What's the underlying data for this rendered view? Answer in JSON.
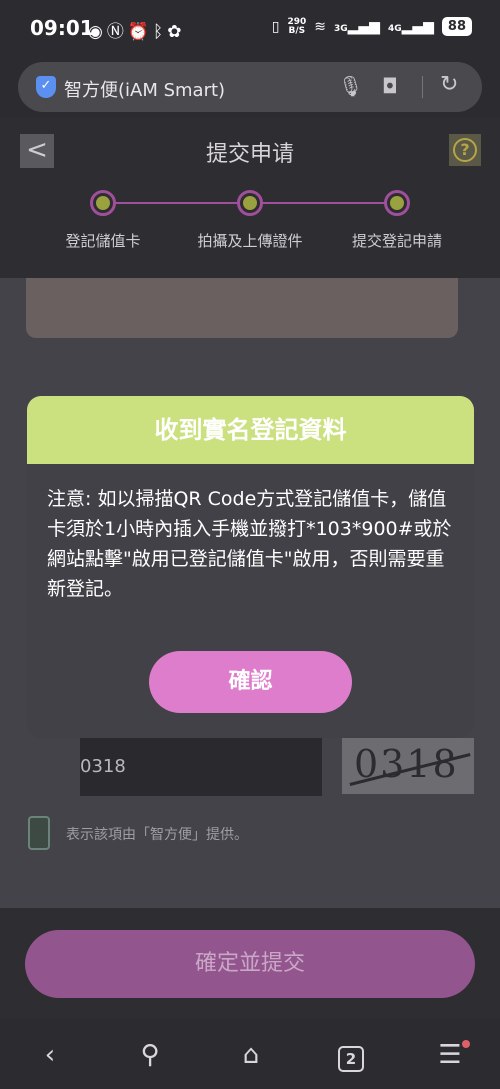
{
  "status_bar": {
    "time": "09:01",
    "left_icons": [
      "eye-icon",
      "nfc-icon",
      "alarm-icon",
      "bluetooth-icon",
      "app-icon"
    ],
    "net_speed_value": "290",
    "net_speed_unit": "B/S",
    "signal1": "3G",
    "signal2": "4G",
    "battery": "88"
  },
  "browser": {
    "url_text": "智方便(iAM Smart)",
    "tab_count": "2"
  },
  "header": {
    "title": "提交申请",
    "back_glyph": "<",
    "help_glyph": "?",
    "steps": [
      {
        "label": "登記儲值卡"
      },
      {
        "label": "拍攝及上傳證件"
      },
      {
        "label": "提交登記申請"
      }
    ]
  },
  "page": {
    "captcha_value": "0318",
    "captcha_image_text": "0318",
    "provided_by_note": "表示該項由「智方便」提供。",
    "submit_label": "確定並提交"
  },
  "modal": {
    "title": "收到實名登記資料",
    "body": "注意: 如以掃描QR Code方式登記儲值卡，儲值卡須於1小時內插入手機並撥打*103*900#或於網站點擊\"啟用已登記儲值卡\"啟用，否則需要重新登記。",
    "confirm_label": "確認"
  },
  "colors": {
    "modal_header": "#cbe07f",
    "confirm_button": "#de7dcb",
    "step_line": "#a04f9a",
    "step_dot": "#9aa13f"
  }
}
